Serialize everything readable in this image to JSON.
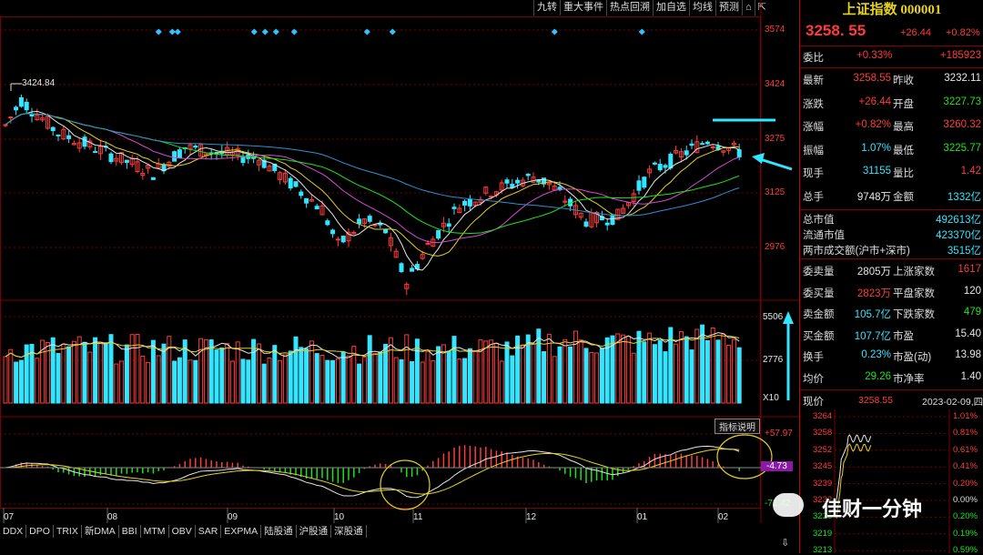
{
  "toolbar": [
    "九转",
    "重大事件",
    "热点回溯",
    "加自选",
    "均线",
    "预测"
  ],
  "main": {
    "high_label": "3424.84",
    "price_axis": [
      "3574",
      "3424",
      "3275",
      "3125",
      "2976"
    ],
    "vol_axis": [
      "5506",
      "2776",
      "X10"
    ],
    "macd_axis": [
      "+57.97",
      "-4.73",
      "-71.42"
    ],
    "indicator_button": "指标说明",
    "months": [
      "07",
      "08",
      "09",
      "10",
      "11",
      "12",
      "01",
      "02"
    ],
    "tabs": [
      "DDX",
      "DPO",
      "TRIX",
      "新DMA",
      "BBI",
      "MTM",
      "OBV",
      "SAR",
      "EXPMA",
      "陆股通",
      "沪股通",
      "深股通"
    ]
  },
  "panel": {
    "title": "上证指数 000001",
    "price": "3258. 55",
    "change": "+26.44",
    "pct": "+0.82%",
    "weibi": {
      "label": "委比",
      "v1": "+0.33%",
      "v2": "+185923"
    },
    "rows": [
      {
        "l1": "最新",
        "v1": "3258.55",
        "l2": "昨收",
        "v2": "3232.11",
        "c1": "red",
        "c2": "wht"
      },
      {
        "l1": "涨跌",
        "v1": "+26.44",
        "l2": "开盘",
        "v2": "3227.73",
        "c1": "red",
        "c2": "green"
      },
      {
        "l1": "涨幅",
        "v1": "+0.82%",
        "l2": "最高",
        "v2": "3260.32",
        "c1": "red",
        "c2": "red"
      },
      {
        "l1": "振幅",
        "v1": "1.07%",
        "l2": "最低",
        "v2": "3225.77",
        "c1": "cyan",
        "c2": "green"
      },
      {
        "l1": "现手",
        "v1": "31155",
        "l2": "量比",
        "v2": "1.42",
        "c1": "cyan",
        "c2": "red"
      },
      {
        "l1": "总手",
        "v1": "9748万",
        "l2": "金额",
        "v2": "1332亿",
        "c1": "wht",
        "c2": "cyan"
      }
    ],
    "mktcap": [
      {
        "l": "总市值",
        "v": "492613亿"
      },
      {
        "l": "流通市值",
        "v": "423370亿"
      },
      {
        "l": "两市成交额(沪市+深市)",
        "v": "3515亿"
      }
    ],
    "rows2": [
      {
        "l1": "委卖量",
        "v1": "2805万",
        "l2": "上涨家数",
        "v2": "1617",
        "c1": "wht",
        "c2": "red"
      },
      {
        "l1": "委买量",
        "v1": "2823万",
        "l2": "平盘家数",
        "v2": "120",
        "c1": "red",
        "c2": "wht"
      },
      {
        "l1": "卖金额",
        "v1": "105.7亿",
        "l2": "下跌家数",
        "v2": "479",
        "c1": "cyan",
        "c2": "green"
      },
      {
        "l1": "买金额",
        "v1": "107.7亿",
        "l2": "市盈",
        "v2": "15.40",
        "c1": "cyan",
        "c2": "wht"
      },
      {
        "l1": "换手",
        "v1": "0.23%",
        "l2": "市盈(动)",
        "v2": "13.98",
        "c1": "cyan",
        "c2": "wht"
      },
      {
        "l1": "均价",
        "v1": "29.26",
        "l2": "市净率",
        "v2": "1.40",
        "c1": "green",
        "c2": "wht"
      }
    ],
    "foot": {
      "label": "现价",
      "price": "3258.55",
      "date": "2023-02-09,四"
    },
    "mini_prices": [
      "3264",
      "3258",
      "3252",
      "3245",
      "3239",
      "3232",
      "3226",
      "3219",
      "3213"
    ],
    "mini_pcts": [
      "1.01%",
      "0.81%",
      "0.61%",
      "0.41%",
      "0.20%",
      "0.00%",
      "0.20%",
      "0.19%",
      "0.59%"
    ],
    "watermark": "佳财一分钟"
  },
  "colors": {
    "up": "#ff3b3b",
    "down": "#33e6ff",
    "ma5": "#e6e6e6",
    "ma10": "#e6d21a",
    "ma20": "#d24bd2",
    "ma30": "#1ae61a",
    "ma60": "#2f8fd0",
    "grid": "#7a0000"
  }
}
